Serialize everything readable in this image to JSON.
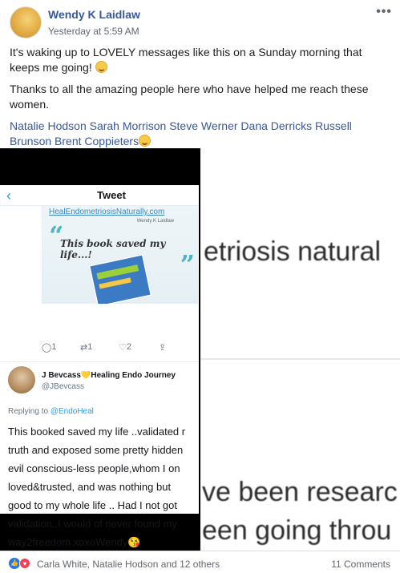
{
  "post": {
    "author": "Wendy K Laidlaw",
    "timestamp": "Yesterday at 5:59 AM",
    "more": "•••",
    "line1": "It's waking up to LOVELY messages like this on a Sunday morning that keeps me going!",
    "line2": "Thanks to all the amazing people here who have helped me reach these women.",
    "tags": "Natalie Hodson Sarah Morrison Steve Werner Dana Derricks Russell Brunson Brent Coppieters"
  },
  "tweet": {
    "title": "Tweet",
    "back": "‹",
    "book_url": "HealEndometriosisNaturally.com",
    "book_sig": "Wendy K Laidlaw",
    "book_quote": "This book saved my life...!",
    "actions": {
      "reply": "1",
      "retweet": "1",
      "like": "2"
    },
    "reply_name": "J Bevcass💛Healing Endo Journey",
    "reply_handle": "@JBevcass",
    "replying_prefix": "Replying to",
    "replying_to": "@EndoHeal",
    "reply_body": "This booked saved my life ..validated r\ntruth and exposed some pretty hidden\nevil conscious-less people,whom I on\nloved&trusted, and was nothing but\ngood to my whole life .. Had I not got\nvalidation..I would of never found my\nway2freedom.xoxoWendy😘"
  },
  "zoom": {
    "line1": "etriosis natural",
    "line2": "ve been researc",
    "line3": "een going throu"
  },
  "footer": {
    "reactors": "Carla White, Natalie Hodson and 12 others",
    "comments": "11 Comments"
  },
  "icons": {
    "like": "thumbs-up-icon",
    "love": "heart-icon"
  }
}
